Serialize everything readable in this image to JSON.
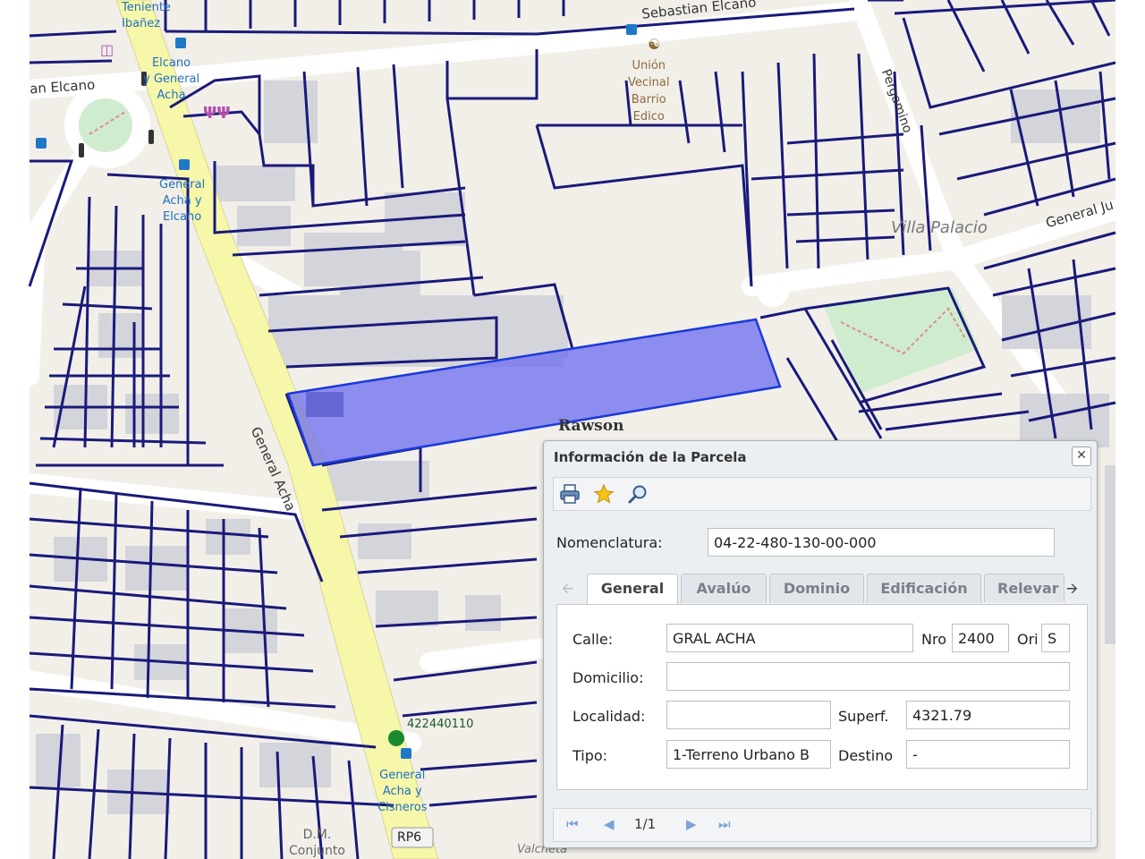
{
  "map": {
    "streets": [
      "Sebastian Elcano",
      "an Elcano",
      "Pergamino",
      "General Ju",
      "General Acha",
      "Valcheta"
    ],
    "places": [
      "Villa Palacio",
      "Rawson"
    ],
    "pois": [
      "Teniente Ibañez",
      "Elcano y General Acha",
      "General Acha y Elcano",
      "Unión Vecinal Barrio Edico",
      "General Acha y Cisneros",
      "D.M. Conjunto"
    ],
    "poi_lines": {
      "teniente": [
        "Teniente",
        "Ibañez"
      ],
      "elcano_acha": [
        "Elcano",
        "y General",
        "Acha"
      ],
      "acha_elcano": [
        "General",
        "Acha y",
        "Elcano"
      ],
      "union": [
        "Unión",
        "Vecinal",
        "Barrio",
        "Edico"
      ],
      "acha_cisneros": [
        "General",
        "Acha y",
        "Cisneros"
      ],
      "dm": [
        "D.M.",
        "Conjunto"
      ]
    },
    "bus_stop_code": "422440110",
    "road_shield": "RP6",
    "colors": {
      "parcel_line": "#1a1a7a",
      "highlight": "#6b6bf0",
      "main_road": "#f6f7a8",
      "block": "#d4d4db",
      "background": "#f2efe9",
      "park": "#cfeccf",
      "bus_marker": "#1a8a2e"
    }
  },
  "dialog": {
    "title": "Información de la Parcela",
    "close_icon": "close-icon",
    "toolbar_icons": [
      "print-icon",
      "star-icon",
      "zoom-icon"
    ],
    "nomenclatura_label": "Nomenclatura:",
    "nomenclatura_value": "04-22-480-130-00-000",
    "tabs": [
      "General",
      "Avalúo",
      "Dominio",
      "Edificación",
      "Relevar"
    ],
    "active_tab": "General",
    "fields": {
      "calle_label": "Calle:",
      "calle_value": "GRAL ACHA",
      "nro_label": "Nro",
      "nro_value": "2400",
      "ori_label": "Ori",
      "ori_value": "S",
      "domicilio_label": "Domicilio:",
      "domicilio_value": "",
      "localidad_label": "Localidad:",
      "localidad_value": "",
      "superf_label": "Superf.",
      "superf_value": "4321.79",
      "tipo_label": "Tipo:",
      "tipo_value": "1-Terreno Urbano B",
      "destino_label": "Destino",
      "destino_value": "-"
    },
    "pager": {
      "page_text": "1/1"
    }
  }
}
